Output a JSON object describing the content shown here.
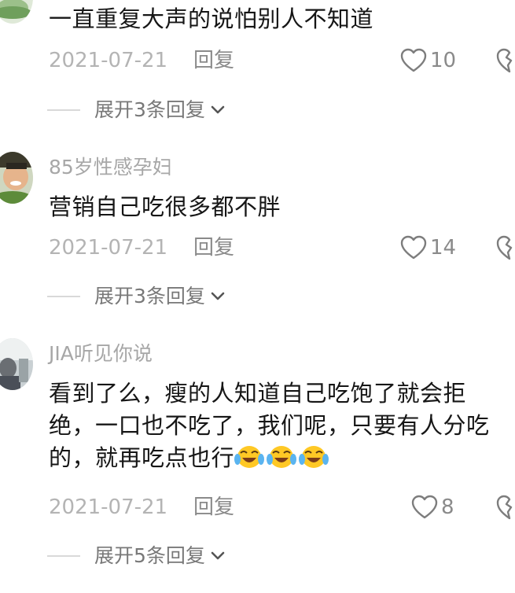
{
  "comments": [
    {
      "username": "",
      "text": "一直重复大声的说怕别人不知道",
      "date": "2021-07-21",
      "reply_label": "回复",
      "likes": "10",
      "expand_label": "展开3条回复"
    },
    {
      "username": "85岁性感孕妇",
      "text": "营销自己吃很多都不胖",
      "date": "2021-07-21",
      "reply_label": "回复",
      "likes": "14",
      "expand_label": "展开3条回复"
    },
    {
      "username": "JIA听见你说",
      "text": "看到了么，瘦的人知道自己吃饱了就会拒绝，一口也不吃了，我们呢，只要有人分吃的，就再吃点也行",
      "emojis": [
        "crying-laughing-emoji",
        "crying-laughing-emoji",
        "crying-laughing-emoji"
      ],
      "date": "2021-07-21",
      "reply_label": "回复",
      "likes": "8",
      "expand_label": "展开5条回复"
    }
  ],
  "colors": {
    "text": "#161616",
    "username": "#a7a7a7",
    "meta": "#b4b4b4",
    "reply": "#8a8a8a",
    "expand": "#787878"
  }
}
